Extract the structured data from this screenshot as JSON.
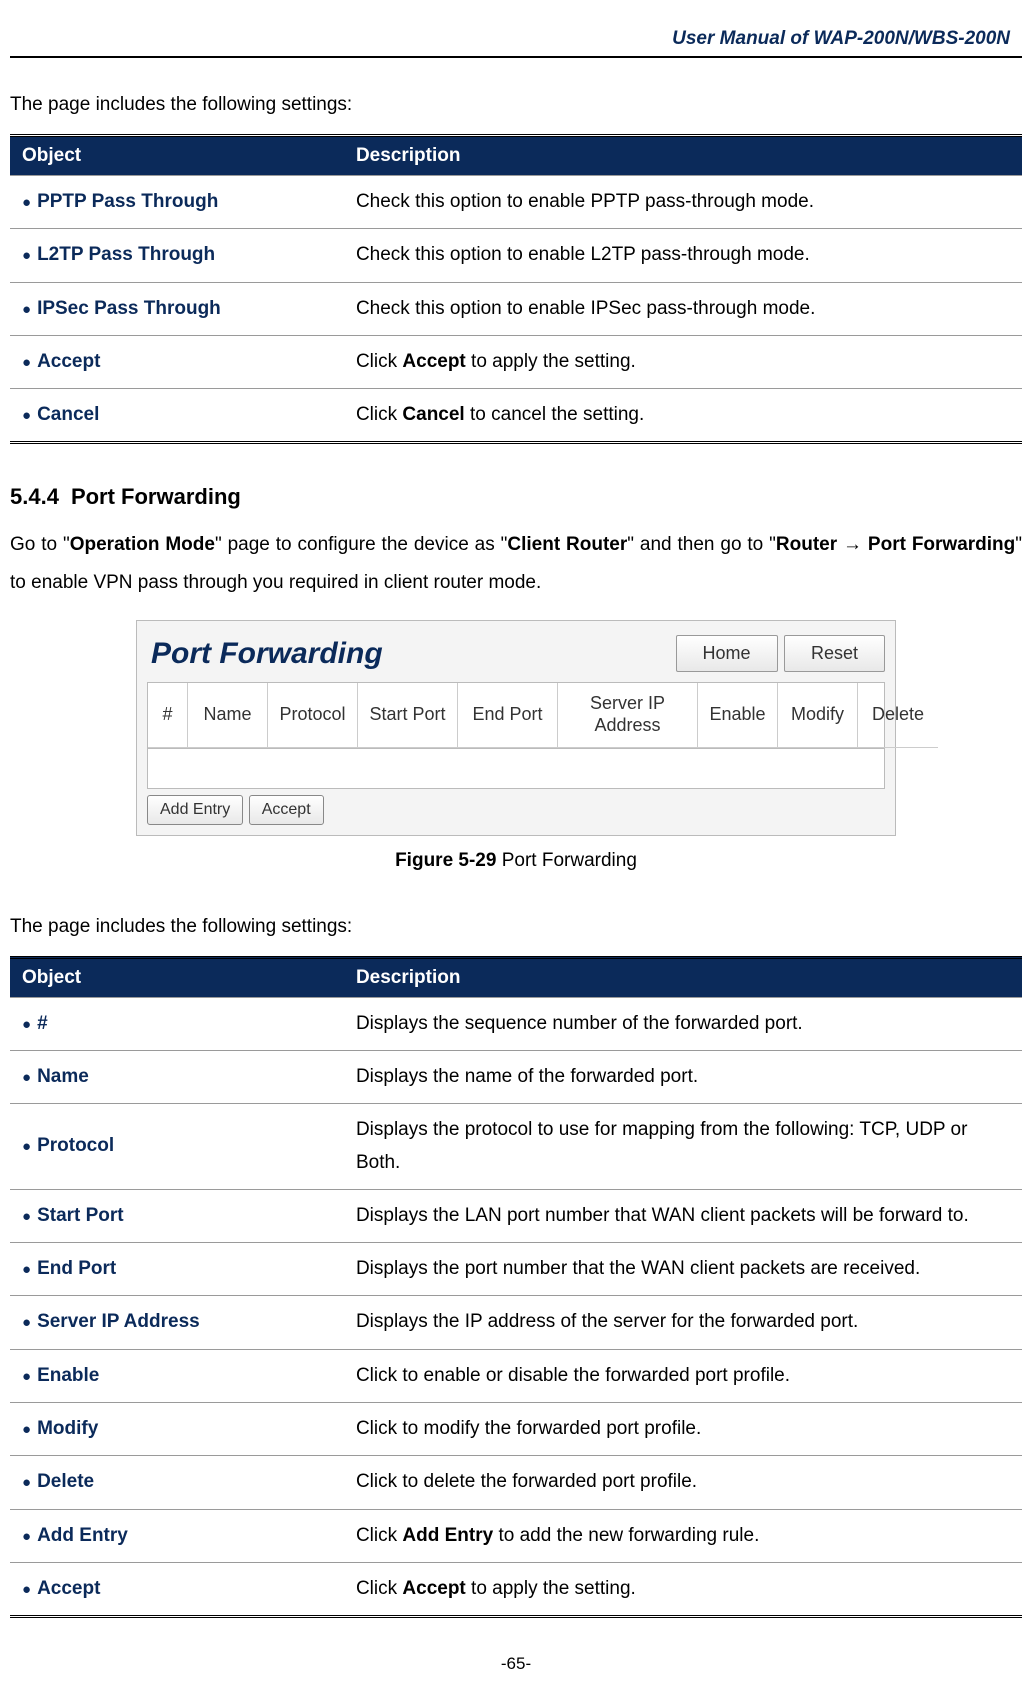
{
  "header": {
    "title": "User Manual of WAP-200N/WBS-200N"
  },
  "intro1": "The page includes the following settings:",
  "table1_head": {
    "c1": "Object",
    "c2": "Description"
  },
  "table1": [
    {
      "obj": "PPTP Pass Through",
      "desc_plain": "Check this option to enable PPTP pass-through mode."
    },
    {
      "obj": "L2TP Pass Through",
      "desc_plain": "Check this option to enable L2TP pass-through mode."
    },
    {
      "obj": "IPSec Pass Through",
      "desc_plain": "Check this option to enable IPSec pass-through mode."
    },
    {
      "obj": "Accept",
      "desc_pre": "Click ",
      "desc_bold": "Accept",
      "desc_post": " to apply the setting."
    },
    {
      "obj": "Cancel",
      "desc_pre": "Click ",
      "desc_bold": "Cancel",
      "desc_post": " to cancel the setting."
    }
  ],
  "section": {
    "num": "5.4.4",
    "title": "Port Forwarding"
  },
  "section_para": {
    "p1": "Go to \"",
    "b1": "Operation Mode",
    "p2": "\" page to configure the device as \"",
    "b2": "Client Router",
    "p3": "\" and then go to \"",
    "b3_a": "Router",
    "arrow": " → ",
    "b3_b": "Port Forwarding",
    "p4": "\" to enable VPN pass through you required in client router mode."
  },
  "figure": {
    "title": "Port Forwarding",
    "btn_home": "Home",
    "btn_reset": "Reset",
    "cols": {
      "c1": "#",
      "c2": "Name",
      "c3": "Protocol",
      "c4": "Start Port",
      "c5": "End Port",
      "c6": "Server IP Address",
      "c7": "Enable",
      "c8": "Modify",
      "c9": "Delete"
    },
    "btn_add": "Add Entry",
    "btn_accept": "Accept",
    "caption_b": "Figure 5-29",
    "caption_rest": " Port Forwarding"
  },
  "intro2": "The page includes the following settings:",
  "table2_head": {
    "c1": "Object",
    "c2": "Description"
  },
  "table2": [
    {
      "obj": "#",
      "desc_plain": "Displays the sequence number of the forwarded port."
    },
    {
      "obj": "Name",
      "desc_plain": "Displays the name of the forwarded port."
    },
    {
      "obj": "Protocol",
      "desc_plain": "Displays the protocol to use for mapping from the following: TCP, UDP or Both."
    },
    {
      "obj": "Start Port",
      "desc_plain": "Displays the LAN port number that WAN client packets will be forward to."
    },
    {
      "obj": "End Port",
      "desc_plain": "Displays the port number that the WAN client packets are received."
    },
    {
      "obj": "Server IP Address",
      "desc_plain": "Displays the IP address of the server for the forwarded port."
    },
    {
      "obj": "Enable",
      "desc_plain": "Click to enable or disable the forwarded port profile."
    },
    {
      "obj": "Modify",
      "desc_plain": "Click to modify the forwarded port profile."
    },
    {
      "obj": "Delete",
      "desc_plain": "Click to delete the forwarded port profile."
    },
    {
      "obj": "Add Entry",
      "desc_pre": "Click ",
      "desc_bold": "Add Entry",
      "desc_post": " to add the new forwarding rule."
    },
    {
      "obj": "Accept",
      "desc_pre": "Click ",
      "desc_bold": "Accept",
      "desc_post": " to apply the setting."
    }
  ],
  "page_num": "-65-"
}
